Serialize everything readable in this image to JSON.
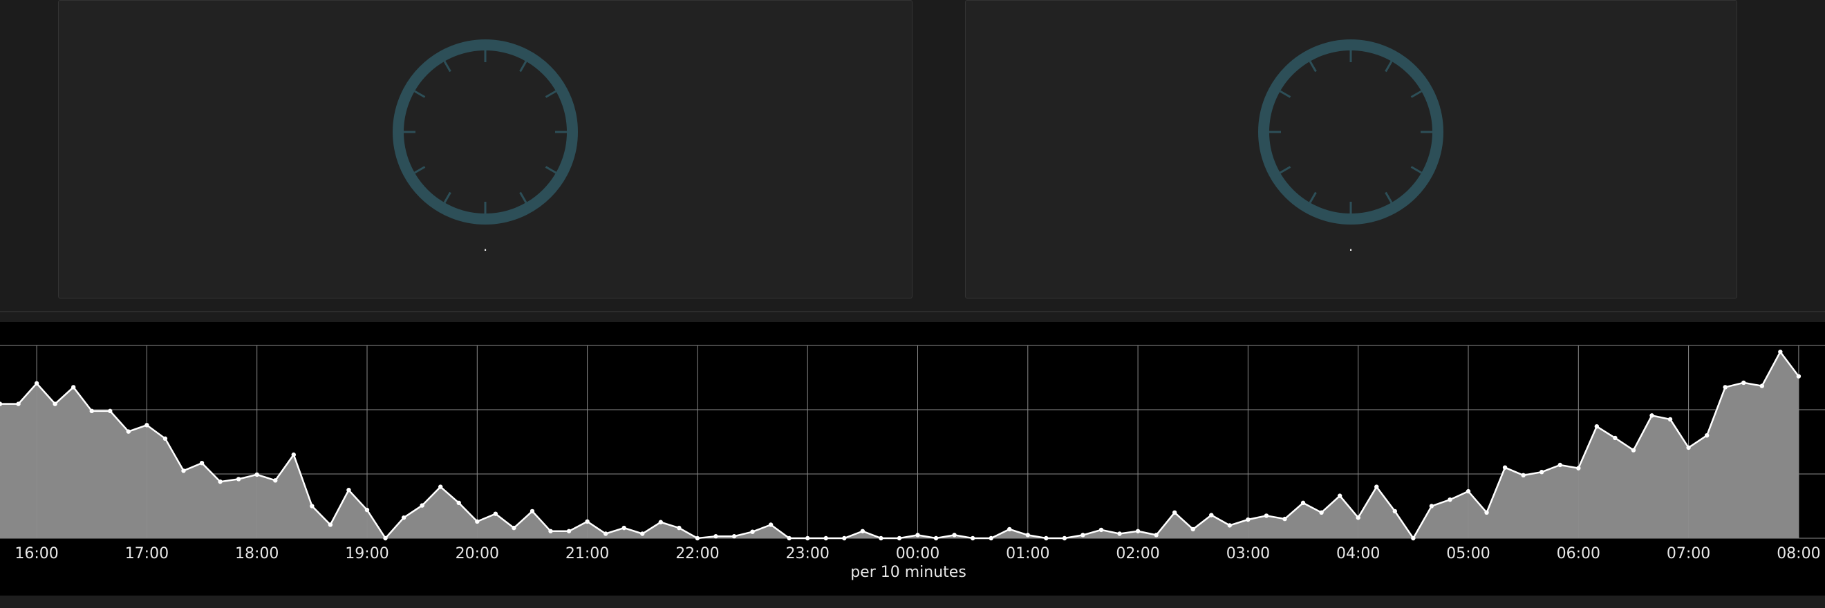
{
  "colors": {
    "gauge_ring": "#2d4f58",
    "gauge_tick": "#2d4f58",
    "gauge_center": "#222222",
    "area_fill": "#888888",
    "line": "#ffffff",
    "grid": "#8c8c8c",
    "text": "#e8e8e8"
  },
  "gauges": [
    {
      "name": "gauge-left",
      "value_text": "."
    },
    {
      "name": "gauge-right",
      "value_text": "."
    }
  ],
  "chart_data": {
    "type": "area",
    "title": "",
    "xlabel": "per 10 minutes",
    "ylabel": "",
    "grid": true,
    "x_start": "15:40",
    "x_step_minutes": 10,
    "tick_labels": [
      "16:00",
      "17:00",
      "18:00",
      "19:00",
      "20:00",
      "21:00",
      "22:00",
      "23:00",
      "00:00",
      "01:00",
      "02:00",
      "03:00",
      "04:00",
      "05:00",
      "06:00",
      "07:00",
      "08:00"
    ],
    "ylim": [
      0,
      3
    ],
    "series": [
      {
        "name": "",
        "values": [
          2.09,
          2.09,
          2.41,
          2.09,
          2.35,
          1.98,
          1.98,
          1.66,
          1.76,
          1.55,
          1.05,
          1.17,
          0.88,
          0.92,
          0.99,
          0.9,
          1.3,
          0.5,
          0.21,
          0.75,
          0.44,
          0.0,
          0.32,
          0.51,
          0.8,
          0.55,
          0.26,
          0.38,
          0.16,
          0.42,
          0.11,
          0.11,
          0.26,
          0.07,
          0.16,
          0.07,
          0.25,
          0.16,
          0.0,
          0.03,
          0.03,
          0.1,
          0.21,
          0.0,
          0.0,
          0.0,
          0.0,
          0.11,
          0.0,
          0.0,
          0.05,
          0.0,
          0.05,
          0.0,
          0.0,
          0.14,
          0.05,
          0.0,
          0.0,
          0.05,
          0.13,
          0.07,
          0.11,
          0.05,
          0.4,
          0.14,
          0.36,
          0.2,
          0.29,
          0.35,
          0.3,
          0.55,
          0.4,
          0.66,
          0.32,
          0.8,
          0.42,
          0.0,
          0.5,
          0.6,
          0.73,
          0.4,
          1.1,
          0.98,
          1.03,
          1.14,
          1.09,
          1.74,
          1.56,
          1.37,
          1.91,
          1.85,
          1.41,
          1.6,
          2.35,
          2.42,
          2.37,
          2.9,
          2.52
        ]
      }
    ]
  }
}
